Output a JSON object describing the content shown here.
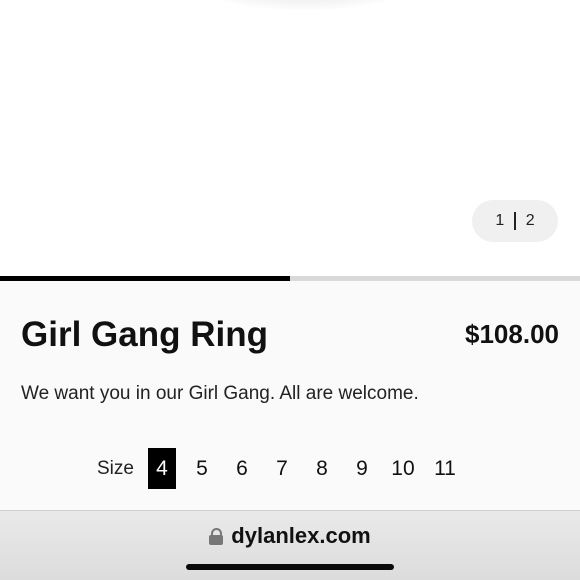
{
  "gallery": {
    "pager_current": "1",
    "pager_total": "2",
    "progress_fraction": 0.5
  },
  "product": {
    "title": "Girl Gang Ring",
    "price": "$108.00",
    "description": "We want you in our Girl Gang. All are welcome."
  },
  "size_selector": {
    "label": "Size",
    "selected": "4",
    "options": [
      "4",
      "5",
      "6",
      "7",
      "8",
      "9",
      "10",
      "11"
    ]
  },
  "browser": {
    "url": "dylanlex.com",
    "lock_icon": "lock-icon"
  },
  "colors": {
    "accent": "#000000",
    "track": "#d9d9d9",
    "details_bg": "#fafafa"
  }
}
